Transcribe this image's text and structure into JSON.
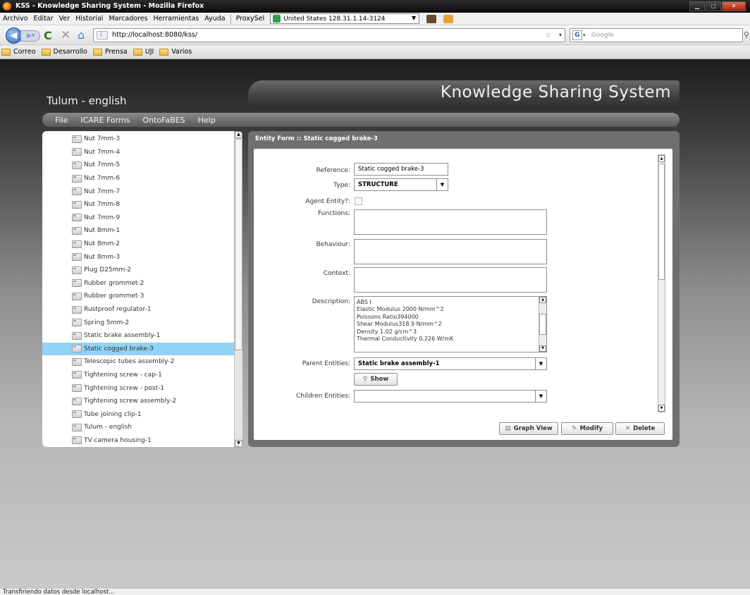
{
  "window": {
    "title": "KSS - Knowledge Sharing System - Mozilla Firefox"
  },
  "browser_menu": [
    "Archivo",
    "Editar",
    "Ver",
    "Historial",
    "Marcadores",
    "Herramientas",
    "Ayuda"
  ],
  "proxy": {
    "label": "ProxySel",
    "selected": "United States 128.31.1.14-3124"
  },
  "nav": {
    "url": "http://localhost:8080/kss/",
    "search_placeholder": "Google"
  },
  "bookmarks": [
    "Correo",
    "Desarrollo",
    "Prensa",
    "UJI",
    "Varios"
  ],
  "app": {
    "title": "Tulum - english",
    "header": "Knowledge Sharing System",
    "menu": [
      "File",
      "ICARE Forms",
      "OntoFaBES",
      "Help"
    ]
  },
  "tree": {
    "items": [
      "Nut 7mm-3",
      "Nut 7mm-4",
      "Nut 7mm-5",
      "Nut 7mm-6",
      "Nut 7mm-7",
      "Nut 7mm-8",
      "Nut 7mm-9",
      "Nut 8mm-1",
      "Nut 8mm-2",
      "Nut 8mm-3",
      "Plug D25mm-2",
      "Rubber grommet-2",
      "Rubber grommet-3",
      "Rustproof regulator-1",
      "Spring 5mm-2",
      "Static brake assembly-1",
      "Static cogged brake-3",
      "Telescopic tubes assembly-2",
      "Tightening screw - cap-1",
      "Tightening screw - post-1",
      "Tightening screw assembly-2",
      "Tube joining clip-1",
      "Tulum - english",
      "TV camera housing-1"
    ],
    "selected": "Static cogged brake-3"
  },
  "form": {
    "title": "Entity Form :: Static cogged brake-3",
    "labels": {
      "reference": "Reference:",
      "type": "Type:",
      "agent": "Agent Entity?:",
      "functions": "Functions:",
      "behaviour": "Behaviour:",
      "context": "Context:",
      "description": "Description:",
      "parents": "Parent Entities:",
      "children": "Children Entities:"
    },
    "reference_value": "Static cogged brake-3",
    "type_value": "STRUCTURE",
    "agent_checked": false,
    "description_lines": [
      "ABS I",
      "Elastic Modulus    2000 N/mm^2",
      "Poissons Ratio394000",
      "Shear Modulus318.9 N/mm^2",
      "Density 1.02 g/cm^3",
      "Thermal Conductivity 0.226 W/mK"
    ],
    "parent_value": "Static brake assembly-1",
    "children_value": "",
    "show_label": "Show",
    "graph_view_label": "Graph View",
    "modify_label": "Modify",
    "delete_label": "Delete"
  },
  "status": {
    "text": "Transfiriendo datos desde localhost..."
  }
}
